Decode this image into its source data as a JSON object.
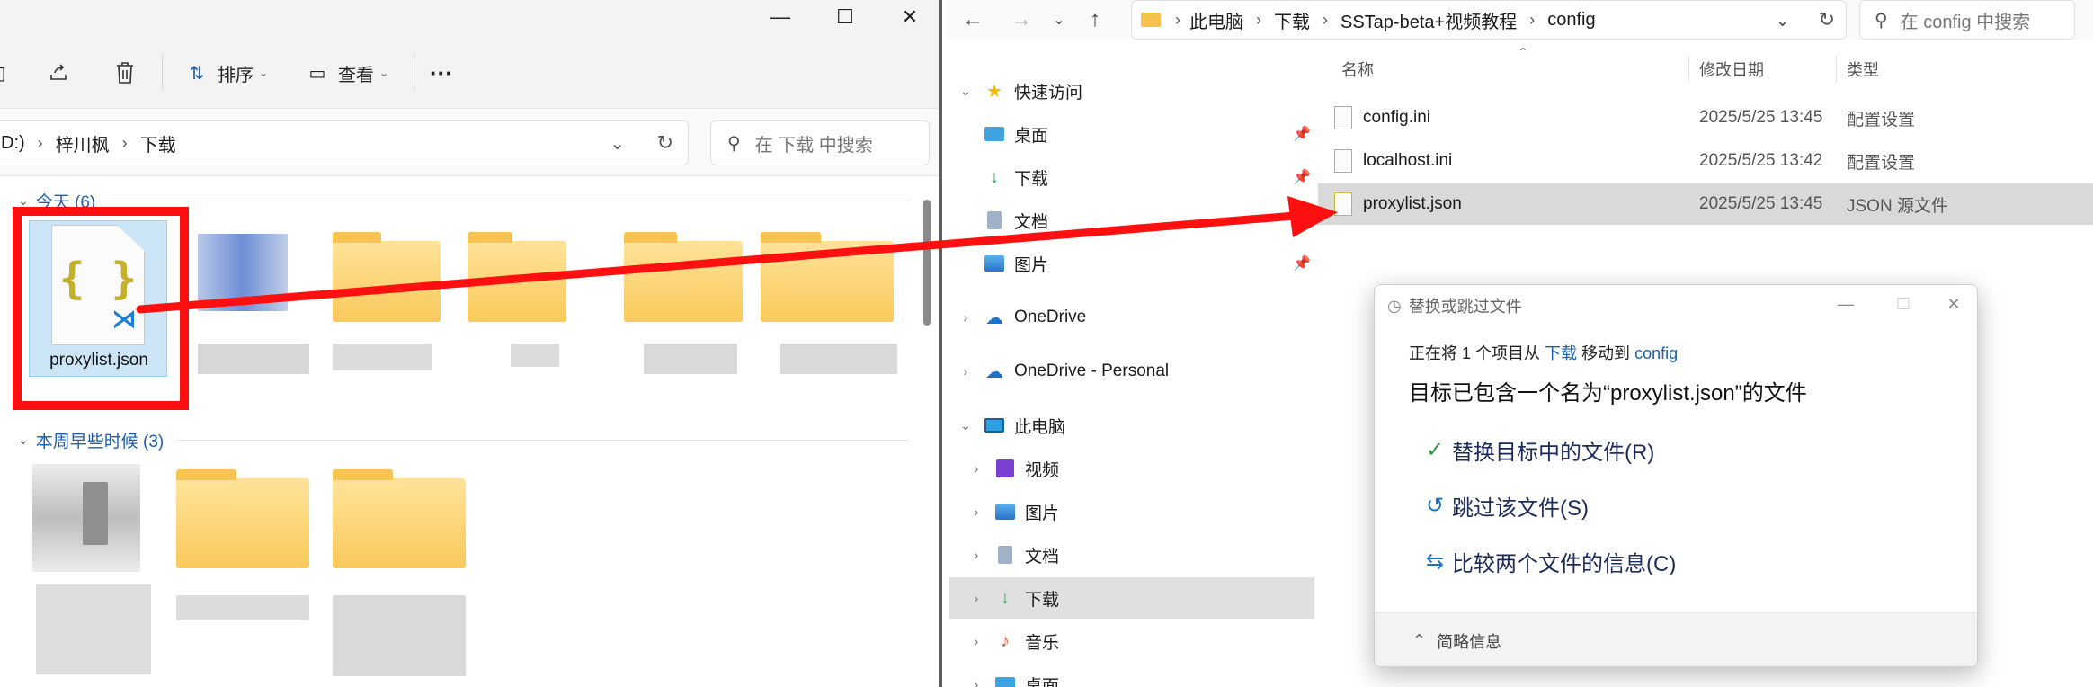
{
  "left": {
    "toolbar": {
      "sort_label": "排序",
      "view_label": "查看"
    },
    "breadcrumb": [
      "D:)",
      "梓川枫",
      "下载"
    ],
    "search_placeholder": "在 下载 中搜索",
    "groups": [
      {
        "label": "今天 (6)"
      },
      {
        "label": "本周早些时候 (3)"
      }
    ],
    "selected_file": {
      "name": "proxylist.json",
      "icon_glyph": "{ }",
      "badge_glyph": "⋊"
    }
  },
  "right": {
    "breadcrumb": [
      "此电脑",
      "下载",
      "SSTap-beta+视频教程",
      "config"
    ],
    "search_placeholder": "在 config 中搜索",
    "nav": [
      {
        "label": "快速访问",
        "icon": "star-icon"
      },
      {
        "label": "桌面",
        "icon": "desktop-icon"
      },
      {
        "label": "下载",
        "icon": "download-icon"
      },
      {
        "label": "文档",
        "icon": "document-icon"
      },
      {
        "label": "图片",
        "icon": "picture-icon"
      },
      {
        "label": "OneDrive",
        "icon": "cloud-icon"
      },
      {
        "label": "OneDrive - Personal",
        "icon": "cloud-icon"
      },
      {
        "label": "此电脑",
        "icon": "computer-icon"
      },
      {
        "label": "视频",
        "icon": "video-icon"
      },
      {
        "label": "图片",
        "icon": "picture-icon"
      },
      {
        "label": "文档",
        "icon": "document-icon"
      },
      {
        "label": "下载",
        "icon": "download-icon"
      },
      {
        "label": "音乐",
        "icon": "music-icon"
      },
      {
        "label": "桌面",
        "icon": "desktop-icon"
      }
    ],
    "columns": {
      "name": "名称",
      "date": "修改日期",
      "type": "类型"
    },
    "files": [
      {
        "name": "config.ini",
        "date": "2025/5/25 13:45",
        "type": "配置设置"
      },
      {
        "name": "localhost.ini",
        "date": "2025/5/25 13:42",
        "type": "配置设置"
      },
      {
        "name": "proxylist.json",
        "date": "2025/5/25 13:45",
        "type": "JSON 源文件"
      }
    ]
  },
  "dialog": {
    "title": "替换或跳过文件",
    "sub_prefix": "正在将 1 个项目从",
    "sub_from": "下载",
    "sub_mid": "移动到",
    "sub_to": "config",
    "main": "目标已包含一个名为“proxylist.json”的文件",
    "options": [
      {
        "label": "替换目标中的文件(R)",
        "icon": "check-icon",
        "color": "#2e9e3e"
      },
      {
        "label": "跳过该文件(S)",
        "icon": "undo-icon",
        "color": "#1a73c9"
      },
      {
        "label": "比较两个文件的信息(C)",
        "icon": "compare-icon",
        "color": "#1a73c9"
      }
    ],
    "footer": "简略信息"
  },
  "colors": {
    "annotation_red": "#ff1010",
    "link_blue": "#1a5fb4"
  }
}
